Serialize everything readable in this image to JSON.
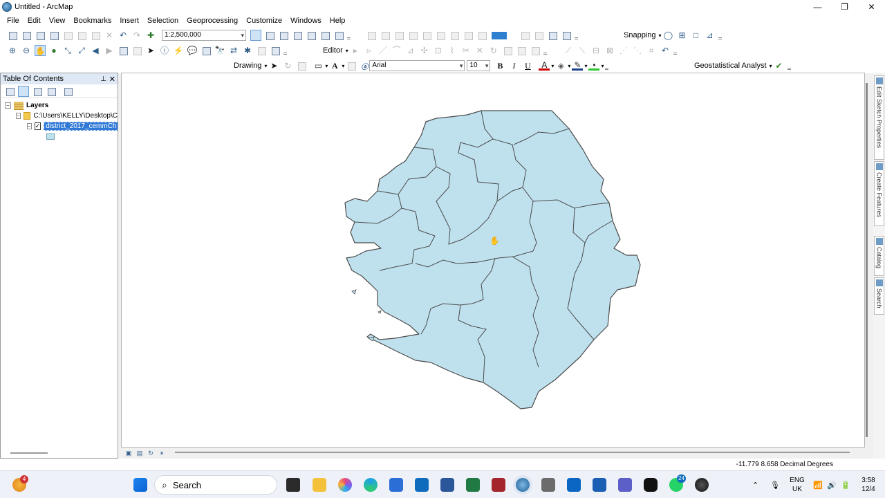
{
  "window": {
    "title": "Untitled - ArcMap",
    "minimize": "—",
    "maximize": "❐",
    "close": "✕"
  },
  "menu": [
    "File",
    "Edit",
    "View",
    "Bookmarks",
    "Insert",
    "Selection",
    "Geoprocessing",
    "Customize",
    "Windows",
    "Help"
  ],
  "toolbar": {
    "scale": "1:2,500,000",
    "snapping_label": "Snapping",
    "editor_label": "Editor",
    "drawing_label": "Drawing",
    "font_name": "Arial",
    "font_size": "10",
    "bold": "B",
    "italic": "I",
    "underline": "U",
    "text_tool": "A",
    "geostat_label": "Geostatistical Analyst"
  },
  "toc": {
    "title": "Table Of Contents",
    "pin": "⊥",
    "close": "✕",
    "root": "Layers",
    "folder": "C:\\Users\\KELLY\\Desktop\\C",
    "layer": "district_2017_cemmCh",
    "expand_minus": "−",
    "checked": "✓"
  },
  "dock_tabs": [
    "Edit Sketch Properties",
    "Create Features",
    "Catalog",
    "Search"
  ],
  "status": {
    "coords": "-11.779  8.658 Decimal Degrees"
  },
  "taskbar": {
    "search_placeholder": "Search",
    "widgets_badge": "4",
    "whatsapp_badge": "24",
    "language": "ENG",
    "region": "UK",
    "time": "3:58",
    "date": "12/4"
  },
  "colors": {
    "map_fill": "#bfe1ee",
    "map_stroke": "#4a4a4a",
    "selection": "#3079d6"
  }
}
